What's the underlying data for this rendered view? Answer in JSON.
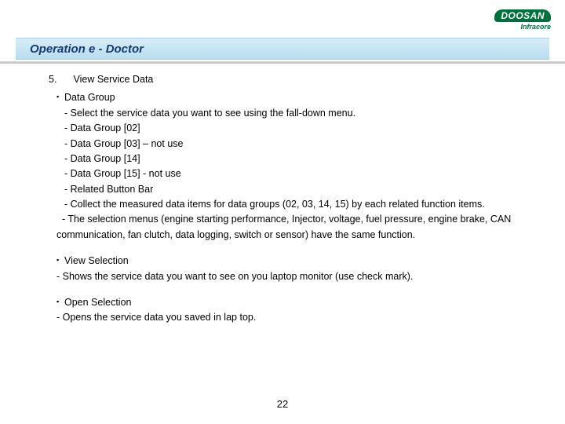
{
  "logo": {
    "main": "DOOSAN",
    "sub": "Infracore"
  },
  "title": {
    "pre": "Operation ",
    "em": "e",
    "post": " - Doctor"
  },
  "section": {
    "number": "5.",
    "title": "View Service Data"
  },
  "dataGroup": {
    "heading": "Data Group",
    "lines": [
      "- Select the service data you want to see using the fall-down menu.",
      "- Data Group [02]",
      "- Data Group [03] – not  use",
      "- Data Group [14]",
      "- Data Group [15] - not use",
      "- Related Button Bar",
      "- Collect the measured data items for data groups (02, 03, 14, 15) by each related function items.",
      "  - The selection menus (engine starting performance, Injector, voltage, fuel pressure, engine brake, CAN communication, fan clutch, data logging, switch or sensor) have the same function."
    ]
  },
  "viewSelection": {
    "heading": "View Selection",
    "line": "- Shows the service data you want to see on you laptop monitor (use check mark)."
  },
  "openSelection": {
    "heading": "Open Selection",
    "line": "- Opens the service data you saved in lap top."
  },
  "pageNumber": "22"
}
